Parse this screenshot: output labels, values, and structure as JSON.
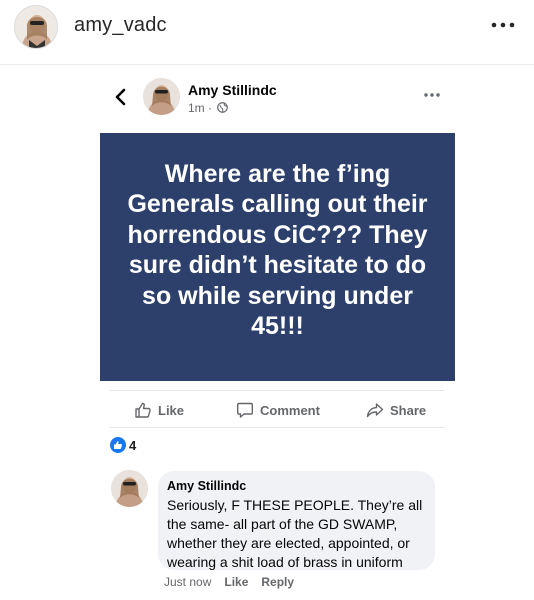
{
  "ig": {
    "username": "amy_vadc"
  },
  "post": {
    "author": "Amy Stillindc",
    "time": "1m",
    "separator": "·",
    "text": "Where are the f’ing Generals calling out their horrendous CiC??? They sure didn’t hesitate to do so while serving under 45!!!",
    "card_color": "#2d3f6b"
  },
  "actions": {
    "like": "Like",
    "comment": "Comment",
    "share": "Share"
  },
  "reactions": {
    "count": "4",
    "icon": "thumbs-up-icon",
    "color": "#1877f2"
  },
  "comment": {
    "author": "Amy Stillindc",
    "text": "Seriously, F THESE PEOPLE. They’re all the same- all part of the GD SWAMP, whether they are elected, appointed, or wearing a shit load of brass in uniform",
    "time": "Just now",
    "like": "Like",
    "reply": "Reply"
  }
}
